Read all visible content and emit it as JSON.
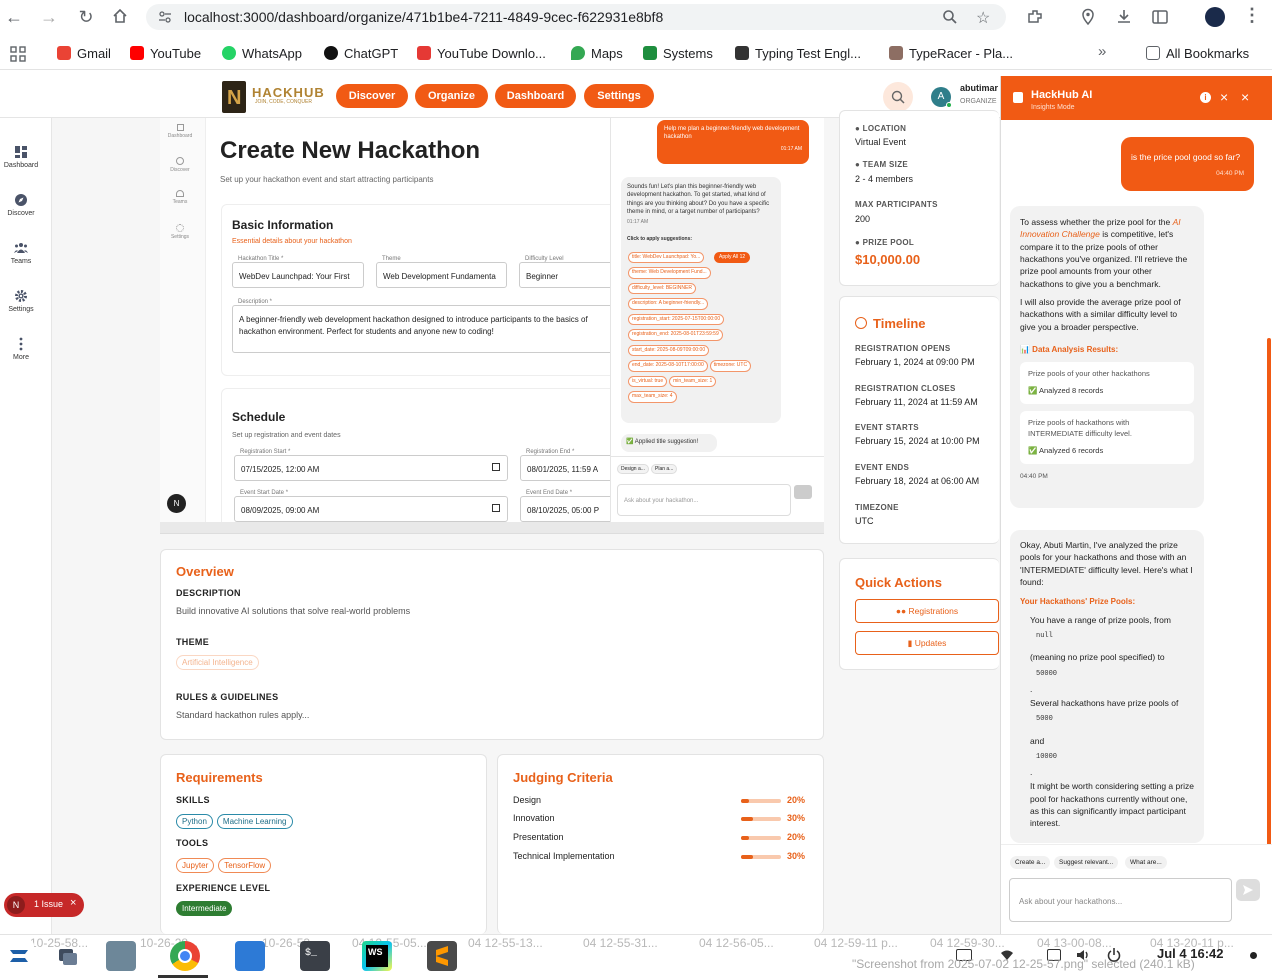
{
  "browser": {
    "url": "localhost:3000/dashboard/organize/471b1be4-7211-4849-9cec-f622931e8bf8",
    "bookmarks": [
      "Gmail",
      "YouTube",
      "WhatsApp",
      "ChatGPT",
      "YouTube Downlo...",
      "Maps",
      "Systems",
      "Typing Test Engl...",
      "TypeRacer - Pla..."
    ],
    "all_bookmarks": "All Bookmarks",
    "colors": {
      "gmail": "#ea4335",
      "youtube": "#ff0000",
      "whatsapp": "#25d366",
      "chatgpt": "#111111",
      "ytdl": "#e53935",
      "maps": "#34a853",
      "systems": "#1e8e3e",
      "typing": "#333333",
      "typeracer": "#8d6e63"
    }
  },
  "header": {
    "logo_text": "HACKHUB",
    "logo_tagline": "JOIN, CODE, CONQUER",
    "nav": [
      "Discover",
      "Organize",
      "Dashboard",
      "Settings"
    ],
    "user_name": "abutimar",
    "user_role": "ORGANIZE",
    "avatar_letter": "A"
  },
  "sidebar": [
    "Dashboard",
    "Discover",
    "Teams",
    "Settings",
    "More"
  ],
  "shot": {
    "mini_sidebar": [
      "Dashboard",
      "Discover",
      "Teams",
      "Settings"
    ],
    "title": "Create New Hackathon",
    "subtitle": "Set up your hackathon event and start attracting participants",
    "basic_title": "Basic Information",
    "basic_sub": "Essential details about your hackathon",
    "fields": {
      "title_label": "Hackathon Title *",
      "title_value": "WebDev Launchpad: Your First",
      "theme_label": "Theme",
      "theme_value": "Web Development Fundamenta",
      "difficulty_label": "Difficulty Level",
      "difficulty_value": "Beginner",
      "desc_label": "Description *",
      "desc_value": "A beginner-friendly web development hackathon designed to introduce participants to the basics of hackathon environment.  Perfect for students and anyone new to coding!"
    },
    "schedule_title": "Schedule",
    "schedule_sub": "Set up registration and event dates",
    "dates": {
      "reg_start_label": "Registration Start *",
      "reg_start": "07/15/2025, 12:00 AM",
      "reg_end_label": "Registration End *",
      "reg_end": "08/01/2025, 11:59 A",
      "ev_start_label": "Event Start Date *",
      "ev_start": "08/09/2025, 09:00 AM",
      "ev_end_label": "Event End Date *",
      "ev_end": "08/10/2025, 05:00 P"
    },
    "n_badge": "N",
    "chat": {
      "user_msg": "Help me plan a beginner-friendly web development hackathon",
      "user_time": "01:17 AM",
      "ai_msg": "Sounds fun! Let's plan this beginner-friendly web development hackathon. To get started, what kind of things are you thinking about? Do you have a specific theme in mind, or a target number of participants?",
      "ai_time": "01:17 AM",
      "apply_label": "Click to apply suggestions:",
      "apply_all": "Apply All 12",
      "suggestions": [
        "title: WebDev Launchpad: Yo...",
        "theme: Web Development Fund...",
        "difficulty_level: BEGINNER",
        "description: A beginner-friendly...",
        "registration_start: 2025-07-15T00:00:00",
        "registration_end: 2025-08-01T23:59:59",
        "start_date: 2025-08-09T09:00:00",
        "end_date: 2025-08-10T17:00:00",
        "timezone: UTC",
        "is_virtual: true",
        "min_team_size: 1",
        "max_team_size: 4"
      ],
      "applied": "✅ Applied title suggestion!",
      "quick": [
        "Design a...",
        "Plan a..."
      ],
      "input_placeholder": "Ask about your hackathon..."
    }
  },
  "overview": {
    "title": "Overview",
    "desc_label": "DESCRIPTION",
    "desc": "Build innovative AI solutions that solve real-world problems",
    "theme_label": "THEME",
    "theme": "Artificial Intelligence",
    "rules_label": "RULES & GUIDELINES",
    "rules": "Standard hackathon rules apply..."
  },
  "requirements": {
    "title": "Requirements",
    "skills_label": "SKILLS",
    "skills": [
      "Python",
      "Machine Learning"
    ],
    "tools_label": "TOOLS",
    "tools": [
      "Jupyter",
      "TensorFlow"
    ],
    "exp_label": "EXPERIENCE LEVEL",
    "exp": "Intermediate"
  },
  "judging": {
    "title": "Judging Criteria",
    "items": [
      {
        "name": "Design",
        "pct": "20%",
        "value": 20
      },
      {
        "name": "Innovation",
        "pct": "30%",
        "value": 30
      },
      {
        "name": "Presentation",
        "pct": "20%",
        "value": 20
      },
      {
        "name": "Technical Implementation",
        "pct": "30%",
        "value": 30
      }
    ]
  },
  "info": {
    "location_label": "LOCATION",
    "location": "Virtual Event",
    "team_label": "TEAM SIZE",
    "team": "2 - 4 members",
    "max_label": "MAX PARTICIPANTS",
    "max": "200",
    "prize_label": "PRIZE POOL",
    "prize": "$10,000.00"
  },
  "timeline": {
    "title": "Timeline",
    "reg_open_label": "REGISTRATION OPENS",
    "reg_open": "February 1, 2024 at 09:00 PM",
    "reg_close_label": "REGISTRATION CLOSES",
    "reg_close": "February 11, 2024 at 11:59 AM",
    "ev_start_label": "EVENT STARTS",
    "ev_start": "February 15, 2024 at 10:00 PM",
    "ev_end_label": "EVENT ENDS",
    "ev_end": "February 18, 2024 at 06:00 AM",
    "tz_label": "TIMEZONE",
    "tz": "UTC"
  },
  "quick_actions": {
    "title": "Quick Actions",
    "registrations": "Registrations",
    "updates": "Updates"
  },
  "issue_badge": {
    "letter": "N",
    "text": "1 Issue"
  },
  "ai": {
    "title": "HackHub AI",
    "mode": "Insights Mode",
    "user_q": "is the price pool good so far?",
    "user_time": "04:40 PM",
    "m1_a": "To assess whether the prize pool for the ",
    "m1_link": "AI Innovation Challenge",
    "m1_b": " is competitive, let's compare it to the prize pools of other hackathons you've organized. I'll retrieve the prize pool amounts from your other hackathons to give you a benchmark.",
    "m1_p2": "I will also provide the average prize pool of hackathons with a similar difficulty level to give you a broader perspective.",
    "analysis_title": "📊 Data Analysis Results:",
    "res1_title": "Prize pools of your other hackathons",
    "res1_val": "✅ Analyzed 8 records",
    "res2_title": "Prize pools of hackathons with INTERMEDIATE difficulty level.",
    "res2_val": "✅ Analyzed 6 records",
    "m1_time": "04:40 PM",
    "m2_intro": "Okay, Abuti Martin, I've analyzed the prize pools for your hackathons and those with an 'INTERMEDIATE' difficulty level. Here's what I found:",
    "m2_heading": "Your Hackathons' Prize Pools:",
    "m2_l1": "You have a range of prize pools, from",
    "m2_c1": "null",
    "m2_l2": "(meaning no prize pool specified) to",
    "m2_c2": "50000",
    "m2_dot": ".",
    "m2_l3": "Several hackathons have prize pools of",
    "m2_c3": "5000",
    "m2_and": "and",
    "m2_c4": "10000",
    "m2_l4": "It might be worth considering setting a prize pool for hackathons currently without one, as this can significantly impact participant interest.",
    "chips": [
      "Create a...",
      "Suggest relevant...",
      "What are..."
    ],
    "input_placeholder": "Ask about your hackathons..."
  },
  "taskbar": {
    "time": "Jul 4  16:42",
    "ghost_items": [
      "10-25-58...",
      "10-26-28...",
      "10-26-53...",
      "04 12-55-05...",
      "04 12-55-13...",
      "04 12-55-31...",
      "04 12-56-05...",
      "04 12-59-11 p...",
      "04 12-59-30...",
      "04 13-00-08...",
      "04 13-20-11 p..."
    ],
    "status_ghost": "\"Screenshot from 2025-07-02 12-25-57.png\" selected (240.1 kB)"
  }
}
